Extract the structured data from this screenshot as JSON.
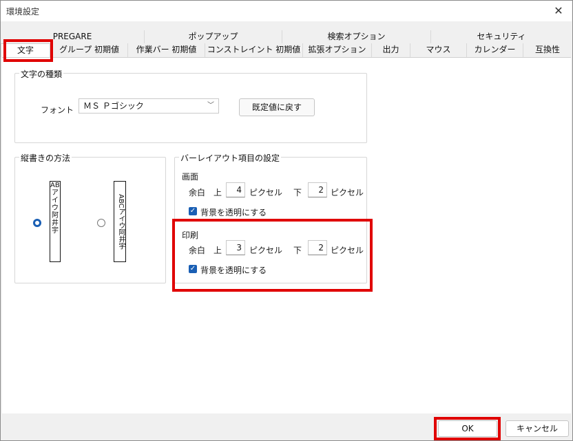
{
  "window": {
    "title": "環境設定",
    "close_glyph": "✕"
  },
  "tabs_top": [
    "PREGARE",
    "ポップアップ",
    "検索オプション",
    "セキュリティ"
  ],
  "tabs_bottom": [
    "文字",
    "グループ 初期値",
    "作業バー 初期値",
    "コンストレイント 初期値",
    "拡張オプション",
    "出力",
    "マウス",
    "カレンダー",
    "互換性"
  ],
  "font_group": {
    "legend": "文字の種類",
    "font_label": "フォント",
    "font_value": "ＭＳ Ｐゴシック",
    "reset_button": "既定値に戻す"
  },
  "vertical_group": {
    "legend": "縦書きの方法",
    "option1_sample": "ABCアイウ阿井宇",
    "option2_sample": "ABCアイウ阿井宇",
    "selected": 1
  },
  "bar_layout": {
    "legend": "バーレイアウト項目の設定",
    "screen": {
      "heading": "画面",
      "margin_label": "余白",
      "top_label": "上",
      "top_value": "4",
      "unit1": "ピクセル",
      "bottom_label": "下",
      "bottom_value": "2",
      "unit2": "ピクセル",
      "transparent_label": "背景を透明にする",
      "transparent_checked": true
    },
    "print": {
      "heading": "印刷",
      "margin_label": "余白",
      "top_label": "上",
      "top_value": "3",
      "unit1": "ピクセル",
      "bottom_label": "下",
      "bottom_value": "2",
      "unit2": "ピクセル",
      "transparent_label": "背景を透明にする",
      "transparent_checked": true
    }
  },
  "footer": {
    "ok": "OK",
    "cancel": "キャンセル"
  },
  "colors": {
    "highlight": "#e00000",
    "accent": "#1a5fb4"
  }
}
